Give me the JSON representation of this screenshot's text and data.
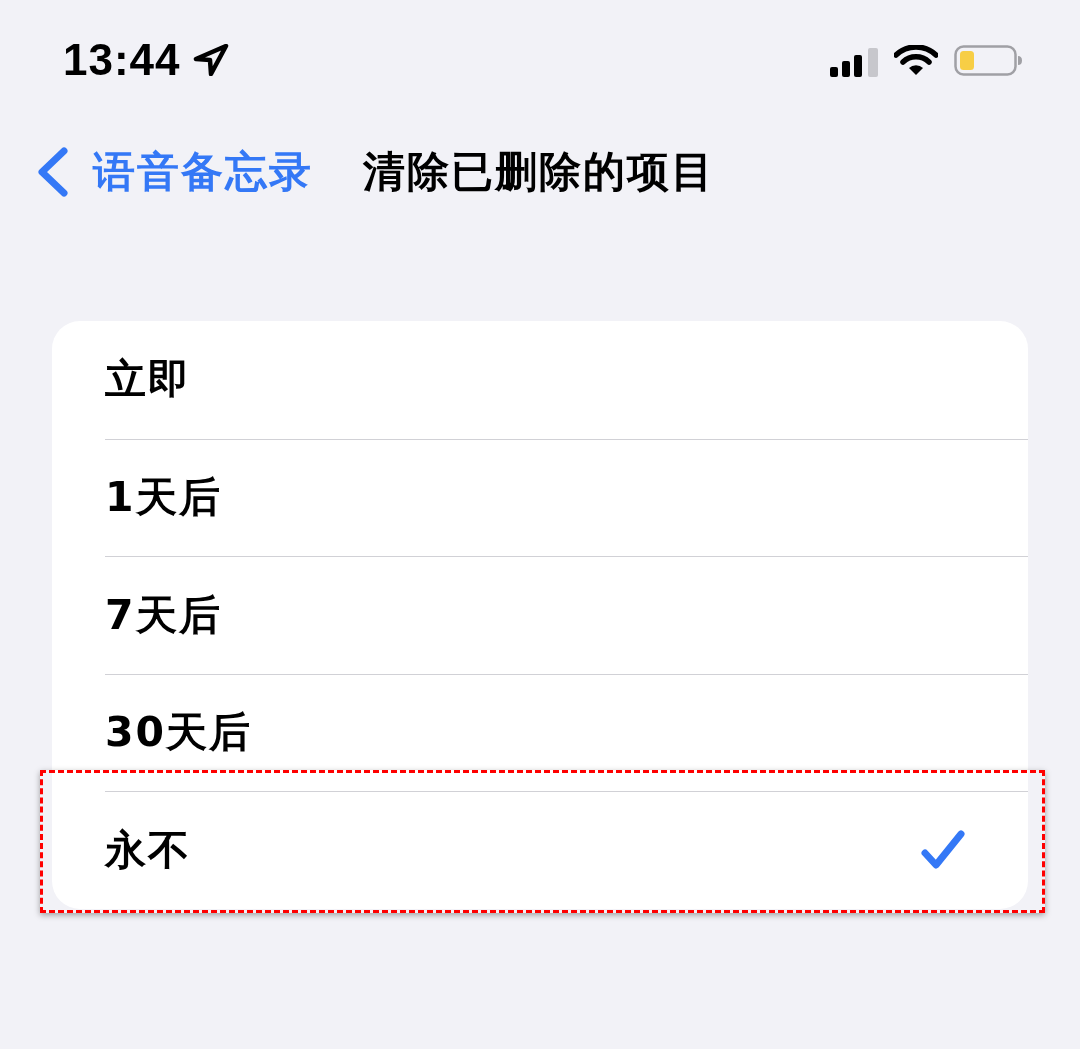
{
  "status_bar": {
    "time": "13:44"
  },
  "nav_bar": {
    "back_label": "语音备忘录",
    "title": "清除已删除的项目"
  },
  "options": [
    {
      "label": "立即",
      "selected": false,
      "highlighted": false
    },
    {
      "label": "1天后",
      "selected": false,
      "highlighted": false
    },
    {
      "label": "7天后",
      "selected": false,
      "highlighted": false
    },
    {
      "label": "30天后",
      "selected": false,
      "highlighted": false
    },
    {
      "label": "永不",
      "selected": true,
      "highlighted": true
    }
  ]
}
